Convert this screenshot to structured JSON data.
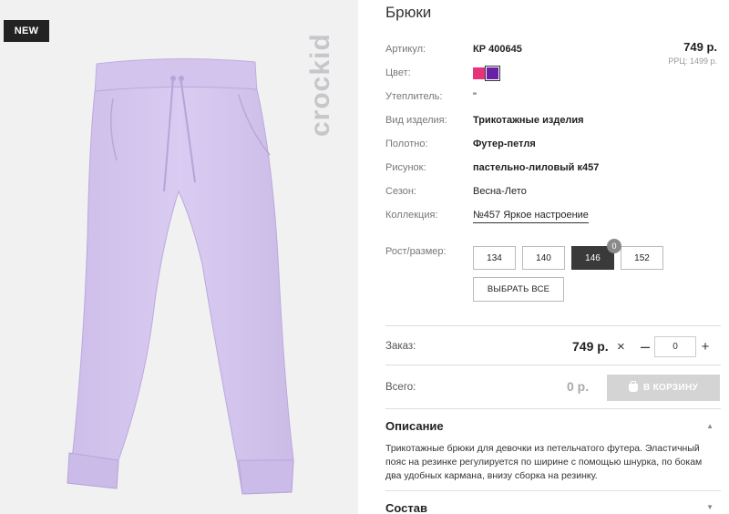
{
  "badge": "NEW",
  "brand": "crockid",
  "product": {
    "title": "Брюки",
    "price": "749 р.",
    "rrp": "РРЦ: 1499 р.",
    "attributes": [
      {
        "label": "Артикул:",
        "value": "КР 400645"
      },
      {
        "label": "Цвет:",
        "value": ""
      },
      {
        "label": "Утеплитель:",
        "value": "\""
      },
      {
        "label": "Вид изделия:",
        "value": "Трикотажные изделия"
      },
      {
        "label": "Полотно:",
        "value": "Футер-петля"
      },
      {
        "label": "Рисунок:",
        "value": "пастельно-лиловый к457"
      },
      {
        "label": "Сезон:",
        "value": "Весна-Лето"
      },
      {
        "label": "Коллекция:",
        "value": "№457 Яркое настроение"
      }
    ],
    "colors": [
      "#e8337a",
      "#6a1fa8"
    ],
    "size_label": "Рост/размер:",
    "sizes": [
      "134",
      "140",
      "146",
      "152"
    ],
    "selected_size": "146",
    "selected_size_count": "0",
    "select_all": "ВЫБРАТЬ ВСЕ"
  },
  "order": {
    "label": "Заказ:",
    "price": "749 р.",
    "times": "×",
    "minus": "–",
    "plus": "+",
    "quantity": "0",
    "total_label": "Всего:",
    "total_value": "0 р.",
    "cart_button": "В КОРЗИНУ"
  },
  "description": {
    "title": "Описание",
    "text": "Трикотажные брюки для девочки из петельчатого футера. Эластичный пояс на резинке регулируется по ширине с помощью шнурка, по бокам два удобных кармана, внизу сборка на резинку."
  },
  "composition": {
    "title": "Состав"
  },
  "icons": {
    "expand": "caret-up-icon",
    "collapse": "caret-down-icon",
    "cart": "bag-icon"
  }
}
